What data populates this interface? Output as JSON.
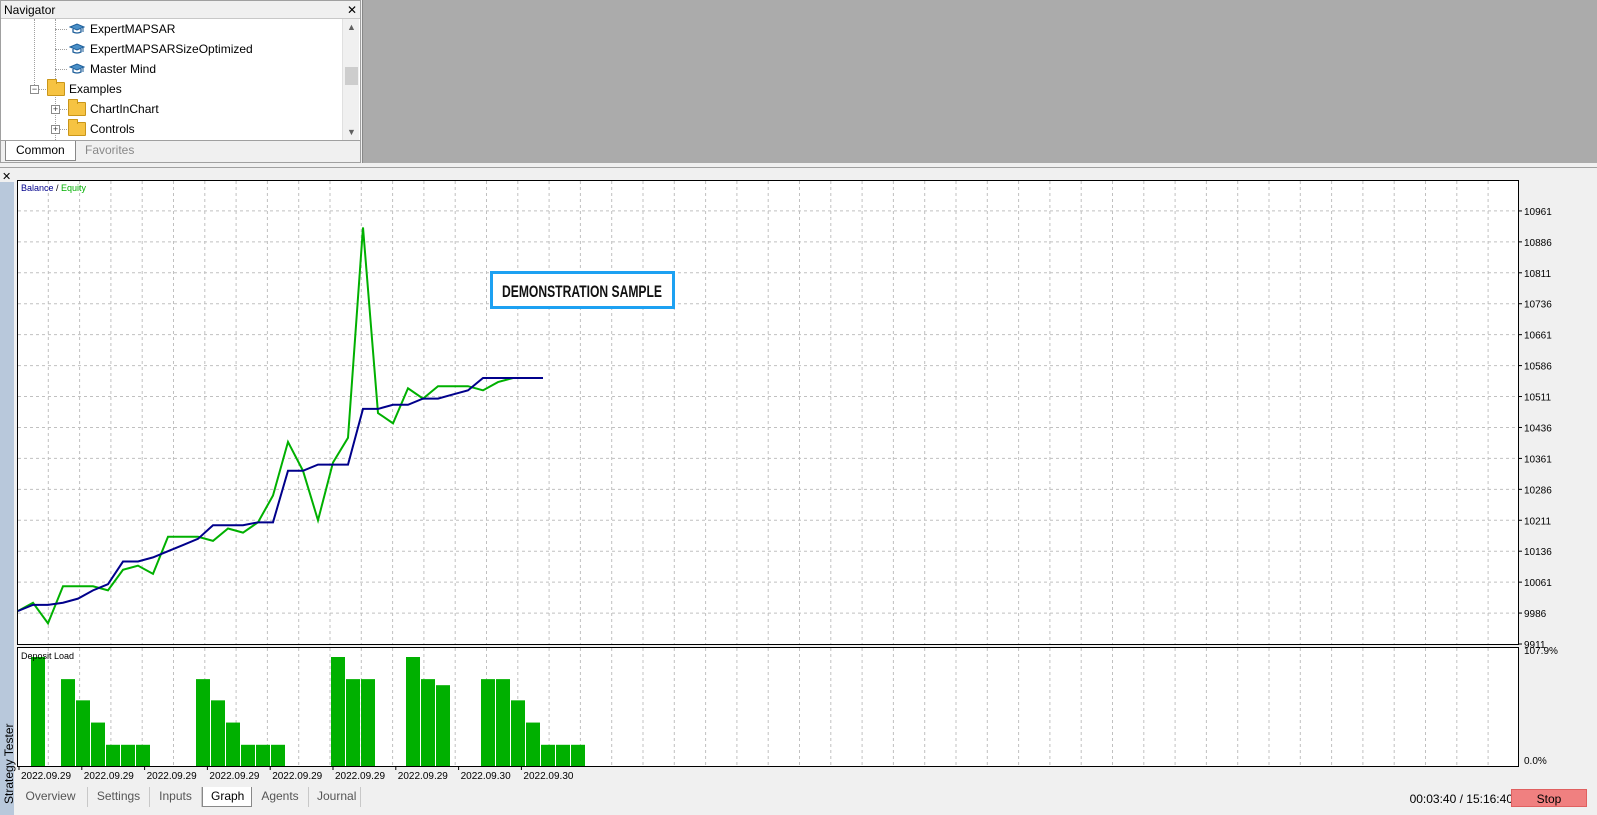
{
  "navigator": {
    "title": "Navigator",
    "close_icon": "close-icon",
    "tree": [
      {
        "label": "ExpertMAPSAR",
        "icon": "expert-advisor-icon",
        "level": 2
      },
      {
        "label": "ExpertMAPSARSizeOptimized",
        "icon": "expert-advisor-icon",
        "level": 2
      },
      {
        "label": "Master Mind",
        "icon": "expert-advisor-icon",
        "level": 2
      },
      {
        "label": "Examples",
        "icon": "folder-icon",
        "level": 1,
        "expander": "−"
      },
      {
        "label": "ChartInChart",
        "icon": "folder-icon",
        "level": 2,
        "expander": "+"
      },
      {
        "label": "Controls",
        "icon": "folder-icon",
        "level": 2,
        "expander": "+"
      }
    ],
    "tabs": {
      "common": "Common",
      "favorites": "Favorites"
    }
  },
  "tester": {
    "label": "Strategy Tester",
    "close_icon": "close-icon",
    "tabs": [
      "Overview",
      "Settings",
      "Inputs",
      "Graph",
      "Agents",
      "Journal"
    ],
    "active_tab": "Graph",
    "time": "00:03:40 / 15:16:40",
    "stop_label": "Stop"
  },
  "chart_data": [
    {
      "type": "line",
      "legend": {
        "balance": "Balance",
        "separator": " / ",
        "equity": "Equity"
      },
      "watermark": "DEMONSTRATION SAMPLE",
      "colors": {
        "balance": "#00008b",
        "equity": "#00b000",
        "grid": "#c0c0c0"
      },
      "ylim": [
        9911,
        11036
      ],
      "yticks": [
        9911,
        9986,
        10061,
        10136,
        10211,
        10286,
        10361,
        10436,
        10511,
        10586,
        10661,
        10736,
        10811,
        10886,
        10961
      ],
      "x_count": 36,
      "series": [
        {
          "name": "Balance",
          "values": [
            9991,
            10006,
            10006,
            10011,
            10021,
            10041,
            10056,
            10111,
            10111,
            10121,
            10136,
            10151,
            10166,
            10199,
            10199,
            10199,
            10206,
            10206,
            10331,
            10331,
            10346,
            10346,
            10346,
            10481,
            10481,
            10491,
            10491,
            10506,
            10506,
            10516,
            10526,
            10556,
            10556,
            10556,
            10556,
            10556
          ]
        },
        {
          "name": "Equity",
          "values": [
            9991,
            10011,
            9961,
            10051,
            10051,
            10051,
            10041,
            10091,
            10101,
            10081,
            10171,
            10171,
            10171,
            10161,
            10191,
            10181,
            10206,
            10271,
            10401,
            10331,
            10211,
            10351,
            10411,
            10921,
            10471,
            10446,
            10531,
            10506,
            10536,
            10536,
            10536,
            10526,
            10546,
            10556,
            10556,
            10556
          ]
        }
      ]
    },
    {
      "type": "bar",
      "title": "Deposit Load",
      "color": "#00b000",
      "ylim": [
        0,
        107.9
      ],
      "ytick_labels": [
        "107.9%",
        "0.0%"
      ],
      "values": [
        107.9,
        0,
        86,
        65,
        43,
        21,
        21,
        21,
        0,
        0,
        0,
        86,
        65,
        43,
        21,
        21,
        21,
        0,
        0,
        0,
        107.9,
        86,
        86,
        0,
        0,
        107.9,
        86,
        80,
        0,
        0,
        86,
        86,
        65,
        43,
        21,
        21,
        21
      ],
      "x_labels": [
        "2022.09.29",
        "2022.09.29",
        "2022.09.29",
        "2022.09.29",
        "2022.09.29",
        "2022.09.29",
        "2022.09.29",
        "2022.09.30",
        "2022.09.30"
      ]
    }
  ]
}
